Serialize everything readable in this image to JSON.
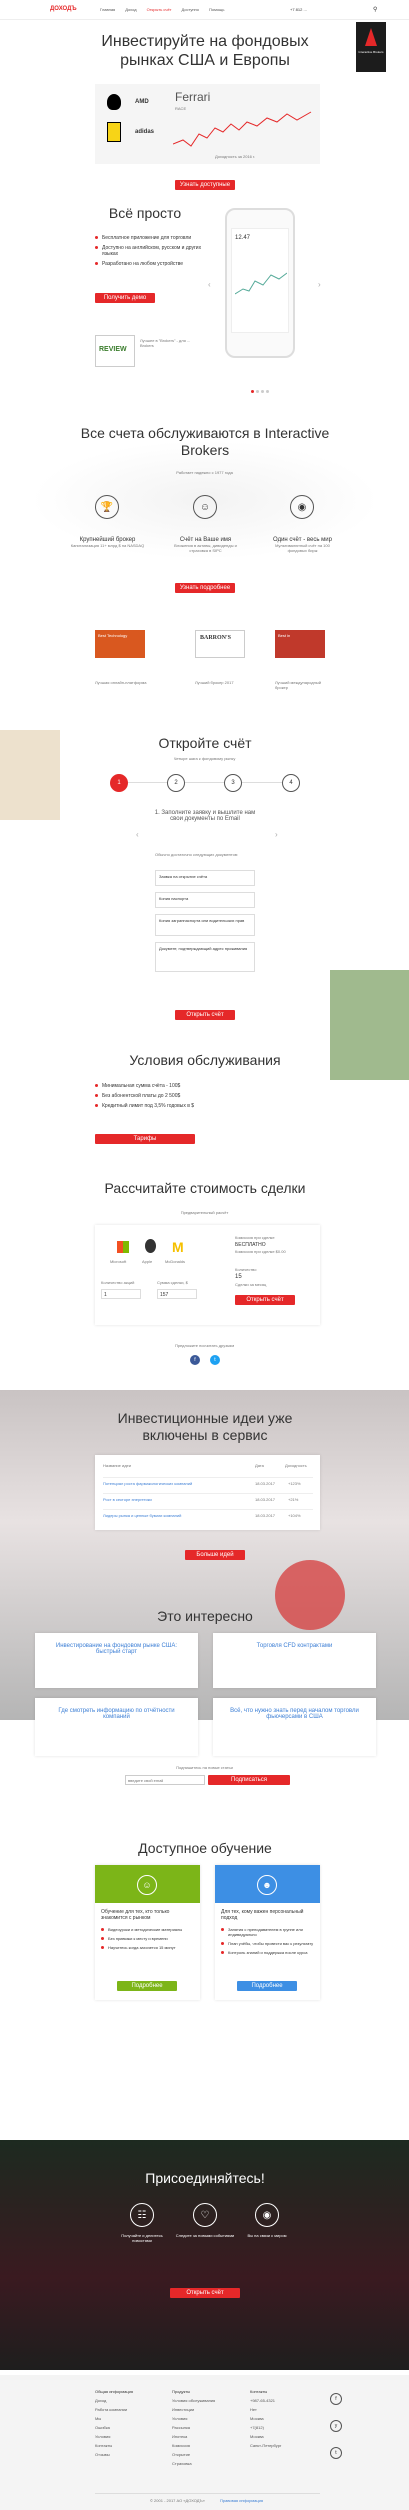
{
  "header": {
    "logo": "ДОХОДЪ",
    "phone": "+7 812 ...",
    "nav": [
      "Главная",
      "Доход",
      "Открыть счёт",
      "Доступно",
      "Помощь"
    ]
  },
  "hero": {
    "title": "Инвестируйте на фондовых рынках США и Европы",
    "ticker": "Ferrari",
    "ticker_sub": "RACE",
    "yield": "Доходность за 2016 г.",
    "brands": [
      "AMD",
      "adidas"
    ],
    "button": "Узнать доступные",
    "ib_badge": "Interactive Brokers"
  },
  "simple": {
    "title": "Всё просто",
    "items": [
      "Бесплатное приложение для торговли",
      "Доступно на английском, русском и других языках",
      "Разработано на любом устройстве"
    ],
    "button": "Получить демо",
    "review_title": "REVIEW",
    "review_text": "Лучшее в \"Brokers\" - для ... Brokers",
    "phone_value": "12.47"
  },
  "ib": {
    "title": "Все счета обслуживаются в Interactive Brokers",
    "subtitle": "Работает надежно с 1977 года",
    "cols": [
      {
        "title": "Крупнейший брокер",
        "text": "Капитализация 11+ млрд $ на NASDAQ"
      },
      {
        "title": "Счёт на Ваше имя",
        "text": "Вложения в активы, дивиденды и страховка в SIPC"
      },
      {
        "title": "Один счёт - весь мир",
        "text": "Мультивалютный счёт на 100 фондовых бирж"
      }
    ],
    "button": "Узнать подробнее",
    "badges": [
      "Best Technology",
      "BARRON'S",
      "Best in"
    ],
    "badge_texts": [
      "Лучшая онлайн-платформа",
      "Лучший брокер 2017",
      "Лучший международный брокер"
    ]
  },
  "open": {
    "title": "Откройте счёт",
    "subtitle": "Четыре шага к фондовому рынку",
    "steps": [
      "1",
      "2",
      "3",
      "4"
    ],
    "step_title": "1. Заполните заявку и вышлите нам свои документы по Email",
    "docs_label": "Обычно достаточно следующих документов:",
    "docs": [
      "Заявка на открытие счёта",
      "Копия паспорта",
      "Копия загранпаспорта или водительских прав",
      "Документ, подтверждающий адрес проживания"
    ],
    "button": "Открыть счёт"
  },
  "terms": {
    "title": "Условия обслуживания",
    "items": [
      "Минимальная сумма счёта - 100$",
      "Без абонентской платы до 2 500$",
      "Кредитный лимит под 3,5% годовых в $"
    ],
    "button": "Тарифы"
  },
  "calc": {
    "title": "Рассчитайте стоимость сделки",
    "label": "Предварительный расчёт",
    "stocks": [
      "Microsoft",
      "Apple",
      "McDonalds"
    ],
    "qty_label": "Количество акций",
    "sum_label": "Сумма сделки, $",
    "qty": "1",
    "sum": "157",
    "fee_label": "Комиссия при сделке",
    "fee": "БЕСПЛАТНО",
    "fee_sub": "Комиссия при сделке $0.00",
    "count_label": "Количество",
    "count": "15",
    "count_sub": "Сделки за месяц",
    "button": "Открыть счёт",
    "share_label": "Предложите посчитать друзьям",
    "shares": [
      "f",
      "t"
    ]
  },
  "ideas": {
    "title": "Инвестиционные идеи уже включены в сервис",
    "col_headers": [
      "Название идеи",
      "Дата",
      "Доходность"
    ],
    "rows": [
      {
        "name": "Потенциал роста фармакологических компаний",
        "date": "18.03.2017",
        "yield": "+123%"
      },
      {
        "name": "Рост в секторе энергетики",
        "date": "18.03.2017",
        "yield": "+21%"
      },
      {
        "name": "Лидеры рынка и ценные бумаги компаний",
        "date": "18.03.2017",
        "yield": "+104%"
      }
    ],
    "button": "Больше идей"
  },
  "interest": {
    "title": "Это интересно",
    "cards": [
      "Инвестирование на фондовом рынке США: быстрый старт",
      "Торговля CFD контрактами",
      "Где смотреть информацию по отчётности компаний",
      "Всё, что нужно знать перед началом торговли фьючерсами в США"
    ],
    "subscribe_label": "Подпишитесь на новые статьи",
    "subscribe_placeholder": "введите свой email",
    "subscribe_button": "Подписаться"
  },
  "edu": {
    "title": "Доступное обучение",
    "cards": [
      {
        "title": "Обучение для тех, кто только знакомится с рынком",
        "items": [
          "Видеоуроки и методические материалы",
          "Без привязки к месту и времени",
          "Научитесь когда захочется 15 минут"
        ],
        "button": "Подробнее"
      },
      {
        "title": "Для тех, кому важен персональный подход",
        "items": [
          "Занятия с преподавателем в группе или индивидуально",
          "План учёбы, чтобы провести вас к результату",
          "Контроль знаний и поддержка после курса"
        ],
        "button": "Подробнее"
      }
    ]
  },
  "join": {
    "title": "Присоединяйтесь!",
    "items": [
      "Получайте и делитесь новостями",
      "Следите за новыми событиями",
      "Вы на связи с миром"
    ],
    "button": "Открыть счёт"
  },
  "footer": {
    "cols": [
      [
        "Общая информация",
        "Доход",
        "Работа компании",
        "Мы",
        "Ошибка",
        "Условия",
        "Контакты",
        "Отзывы"
      ],
      [
        "Продукты",
        "Условия обслуживания",
        "Инвестиции",
        "Условия",
        "Рассылка",
        "Ипотека",
        "Комиссия",
        "Открытие",
        "Страховка"
      ],
      [
        "Контакты",
        "+987-65-4321",
        "Нет",
        "Москва",
        "+7(812)",
        "Москва",
        "Санкт-Петербург"
      ]
    ],
    "social": [
      "f",
      "y",
      "t"
    ],
    "copyright": "© 2001 - 2017 АО «ДОХОДЪ»",
    "legal": "Правовая информация"
  }
}
